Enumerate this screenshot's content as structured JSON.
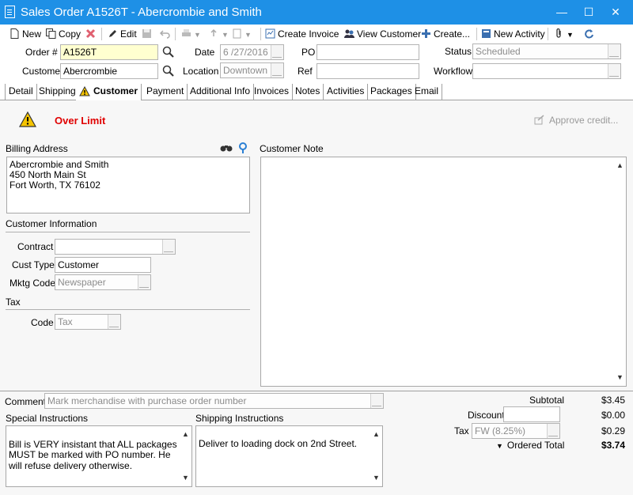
{
  "window": {
    "title": "Sales Order A1526T - Abercrombie and Smith",
    "minimize": "—",
    "maximize": "☐",
    "close": "✕"
  },
  "toolbar": {
    "new": "New",
    "copy": "Copy",
    "edit": "Edit",
    "create_invoice": "Create Invoice",
    "view_customer": "View Customer",
    "create": "Create...",
    "new_activity": "New Activity"
  },
  "header": {
    "order_label": "Order #",
    "order_value": "A1526T",
    "date_label": "Date",
    "date_value": "6 /27/2016",
    "po_label": "PO",
    "po_value": "",
    "status_label": "Status",
    "status_value": "Scheduled",
    "customer_label": "Customer",
    "customer_value": "Abercrombie",
    "location_label": "Location",
    "location_value": "Downtown",
    "ref_label": "Ref",
    "ref_value": "",
    "workflow_label": "Workflow",
    "workflow_value": ""
  },
  "tabs": [
    "Detail",
    "Shipping",
    "Customer",
    "Payment",
    "Additional Info",
    "Invoices",
    "Notes",
    "Activities",
    "Packages",
    "Email"
  ],
  "customer_tab": {
    "alert_text": "Over Limit",
    "approve_credit": "Approve credit...",
    "billing_address_label": "Billing Address",
    "billing_address": "Abercrombie and Smith\n450 North Main St\nFort Worth, TX 76102",
    "customer_note_label": "Customer Note",
    "customer_info_label": "Customer Information",
    "contract_label": "Contract",
    "contract_value": "",
    "cust_type_label": "Cust Type",
    "cust_type_value": "Customer",
    "mktg_code_label": "Mktg Code",
    "mktg_code_value": "Newspaper",
    "tax_section_label": "Tax",
    "tax_code_label": "Code",
    "tax_code_value": "Tax"
  },
  "footer": {
    "comment_label": "Comment",
    "comment_placeholder": "Mark merchandise with purchase order number",
    "special_instructions_label": "Special Instructions",
    "special_instructions": "Bill is VERY insistant that ALL packages MUST be marked with PO number.  He will refuse delivery otherwise.",
    "shipping_instructions_label": "Shipping Instructions",
    "shipping_instructions": "Deliver to loading dock on 2nd Street.",
    "subtotal_label": "Subtotal",
    "subtotal_value": "$3.45",
    "discount_label": "Discount",
    "discount_value": "$0.00",
    "tax_label": "Tax",
    "tax_select": "FW (8.25%)",
    "tax_value": "$0.29",
    "ordered_total_label": "Ordered Total",
    "ordered_total_value": "$3.74"
  },
  "colors": {
    "titlebar": "#1e90e6",
    "alert_red": "#e00000",
    "required_yellow": "#ffffd0"
  }
}
